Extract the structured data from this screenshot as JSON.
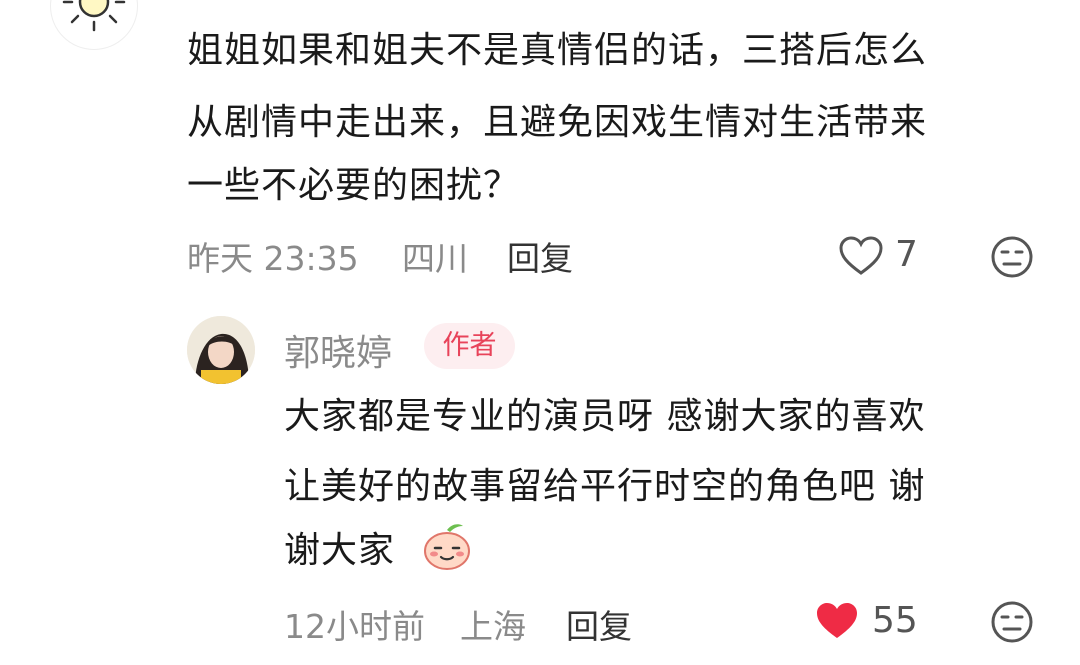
{
  "comment": {
    "text_lines": [
      "姐姐如果和姐夫不是真情侣的话，三搭后怎么",
      "从剧情中走出来，且避免因戏生情对生活带来",
      "一些不必要的困扰？"
    ],
    "time": "昨天 23:35",
    "location": "四川",
    "reply_label": "回复",
    "like_count": "7",
    "like_icon": "heart-outline-icon",
    "dislike_icon": "meh-face-icon"
  },
  "reply": {
    "author": "郭晓婷",
    "badge": "作者",
    "text_lines": [
      "大家都是专业的演员呀 感谢大家的喜欢",
      "让美好的故事留给平行时空的角色吧 谢",
      "谢大家"
    ],
    "emoji": "peach-blushing-emoji",
    "time": "12小时前",
    "location": "上海",
    "reply_label": "回复",
    "like_count": "55",
    "like_icon": "heart-filled-icon",
    "dislike_icon": "meh-face-icon",
    "accent_color": "#e8435a"
  }
}
